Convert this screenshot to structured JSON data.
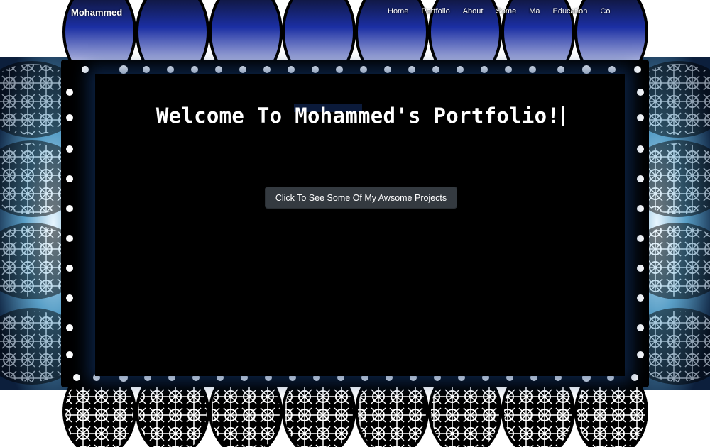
{
  "navbar": {
    "brand": "Mohammed",
    "links": [
      "Home",
      "Portfolio",
      "About",
      "Some",
      "Ma",
      "Education",
      "Co"
    ]
  },
  "hero": {
    "title": "Welcome To Mohammed's Portfolio!",
    "cta_label": "Click To See Some Of My Awsome Projects"
  },
  "colors": {
    "panel": "#000000",
    "button": "#343a40",
    "lace_blue": "#1b2fa3",
    "lace_glow": "#9fd6f2"
  },
  "icons": [
    "lace-frame-decoration"
  ]
}
